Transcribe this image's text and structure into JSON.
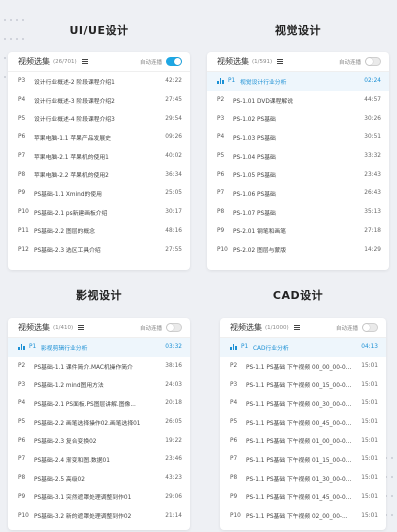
{
  "accent_color": "#1ea7e4",
  "sections": [
    {
      "title": "UI/UE设计",
      "header": {
        "title": "视频选集",
        "count": "(26/701)",
        "autoplay_label": "自动连播",
        "autoplay_on": true
      },
      "items": [
        {
          "num": "P3",
          "title": "设计行业概述-2 阶段课程介绍1",
          "duration": "42:22"
        },
        {
          "num": "P4",
          "title": "设计行业概述-3 阶段课程介绍2",
          "duration": "27:45"
        },
        {
          "num": "P5",
          "title": "设计行业概述-4 阶段课程介绍3",
          "duration": "29:54"
        },
        {
          "num": "P6",
          "title": "苹果电脑-1.1 苹果产品发展史",
          "duration": "09:26"
        },
        {
          "num": "P7",
          "title": "苹果电脑-2.1 苹果机的使用1",
          "duration": "40:02"
        },
        {
          "num": "P8",
          "title": "苹果电脑-2.2 苹果机的使用2",
          "duration": "36:34"
        },
        {
          "num": "P9",
          "title": "PS基础-1.1 Xmind的使用",
          "duration": "25:05"
        },
        {
          "num": "P10",
          "title": "PS基础-2.1 ps新建画板介绍",
          "duration": "30:17"
        },
        {
          "num": "P11",
          "title": "PS基础-2.2 图层的概念",
          "duration": "48:16"
        },
        {
          "num": "P12",
          "title": "PS基础-2.3 选区工具介绍",
          "duration": "27:55"
        }
      ]
    },
    {
      "title": "视觉设计",
      "header": {
        "title": "视频选集",
        "count": "(1/591)",
        "autoplay_label": "自动连播",
        "autoplay_on": false
      },
      "items": [
        {
          "num": "P1",
          "title": "视觉设计行业分析",
          "duration": "02:24",
          "active": true
        },
        {
          "num": "P2",
          "title": "PS-1.01 DVD课程解说",
          "duration": "44:57"
        },
        {
          "num": "P3",
          "title": "PS-1.02 PS基础",
          "duration": "30:26"
        },
        {
          "num": "P4",
          "title": "PS-1.03 PS基础",
          "duration": "30:51"
        },
        {
          "num": "P5",
          "title": "PS-1.04 PS基础",
          "duration": "33:32"
        },
        {
          "num": "P6",
          "title": "PS-1.05 PS基础",
          "duration": "23:43"
        },
        {
          "num": "P7",
          "title": "PS-1.06 PS基础",
          "duration": "26:43"
        },
        {
          "num": "P8",
          "title": "PS-1.07 PS基础",
          "duration": "35:13"
        },
        {
          "num": "P9",
          "title": "PS-2.01 钢笔和画笔",
          "duration": "27:18"
        },
        {
          "num": "P10",
          "title": "PS-2.02 图层与蒙版",
          "duration": "14:29"
        }
      ]
    },
    {
      "title": "影视设计",
      "header": {
        "title": "视频选集",
        "count": "(1/410)",
        "autoplay_label": "自动连播",
        "autoplay_on": false
      },
      "items": [
        {
          "num": "P1",
          "title": "影视剪辑行业分析",
          "duration": "03:32",
          "active": true
        },
        {
          "num": "P2",
          "title": "PS基础-1.1 课件简介.MAC机操作简介",
          "duration": "38:16"
        },
        {
          "num": "P3",
          "title": "PS基础-1.2 mind图用方法",
          "duration": "24:03"
        },
        {
          "num": "P4",
          "title": "PS基础-2.1 PS面板.PS图层讲解.图像...",
          "duration": "20:18"
        },
        {
          "num": "P5",
          "title": "PS基础-2.2 画笔选择操作02.画笔选择01",
          "duration": "26:05"
        },
        {
          "num": "P6",
          "title": "PS基础-2.3 复合变换02",
          "duration": "19:22"
        },
        {
          "num": "P7",
          "title": "PS基础-2.4 渐变和图.数据01",
          "duration": "23:46"
        },
        {
          "num": "P8",
          "title": "PS基础-2.5 高级02",
          "duration": "43:23"
        },
        {
          "num": "P9",
          "title": "PS基础-3.1 突然遮罩处理调整到作01",
          "duration": "29:06"
        },
        {
          "num": "P10",
          "title": "PS基础-3.2 新的遮罩处理调整到作02",
          "duration": "21:14"
        }
      ]
    },
    {
      "title": "CAD设计",
      "header": {
        "title": "视频选集",
        "count": "(1/1000)",
        "autoplay_label": "自动连播",
        "autoplay_on": false
      },
      "items": [
        {
          "num": "P1",
          "title": "CAD行业分析",
          "duration": "04:13",
          "active": true
        },
        {
          "num": "P2",
          "title": "PS-1.1 PS基础 下午视频 00_00_00-0...",
          "duration": "15:01"
        },
        {
          "num": "P3",
          "title": "PS-1.1 PS基础 下午视频 00_15_00-0...",
          "duration": "15:01"
        },
        {
          "num": "P4",
          "title": "PS-1.1 PS基础 下午视频 00_30_00-0...",
          "duration": "15:01"
        },
        {
          "num": "P5",
          "title": "PS-1.1 PS基础 下午视频 00_45_00-0...",
          "duration": "15:01"
        },
        {
          "num": "P6",
          "title": "PS-1.1 PS基础 下午视频 01_00_00-0...",
          "duration": "15:01"
        },
        {
          "num": "P7",
          "title": "PS-1.1 PS基础 下午视频 01_15_00-0...",
          "duration": "15:01"
        },
        {
          "num": "P8",
          "title": "PS-1.1 PS基础 下午视频 01_30_00-0...",
          "duration": "15:01"
        },
        {
          "num": "P9",
          "title": "PS-1.1 PS基础 下午视频 01_45_00-0...",
          "duration": "15:01"
        },
        {
          "num": "P10",
          "title": "PS-1.1 PS基础 下午视频 02_00_00-...",
          "duration": "15:01"
        }
      ]
    }
  ]
}
